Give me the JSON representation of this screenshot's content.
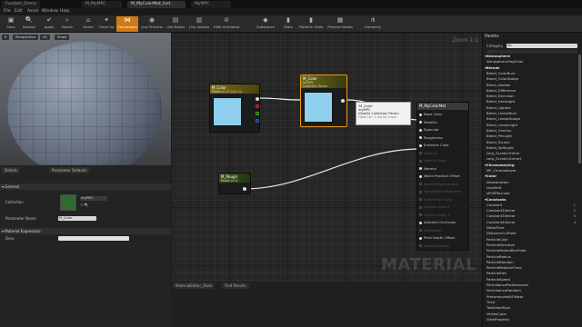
{
  "window": {
    "tabs": [
      "Fundam_Demo",
      "M_MyMPC",
      "M_MyColorMat_Inst",
      "MyMPC"
    ],
    "active_tab": 2
  },
  "menu": [
    "File",
    "Edit",
    "Asset",
    "Window",
    "Help"
  ],
  "toolbar": [
    {
      "icon": "save-icon",
      "label": "Save"
    },
    {
      "icon": "browse-icon",
      "label": "Browse"
    },
    {
      "icon": "apply-icon",
      "label": "Apply"
    },
    {
      "icon": "search-icon",
      "label": "Search"
    },
    {
      "icon": "home-icon",
      "label": "Home"
    },
    {
      "icon": "cleanup-icon",
      "label": "Clean Up"
    },
    {
      "icon": "connectors-icon",
      "label": "Connectors",
      "active": true
    },
    {
      "icon": "live-preview-icon",
      "label": "Live Preview"
    },
    {
      "icon": "live-nodes-icon",
      "label": "Live Nodes"
    },
    {
      "icon": "live-update-icon",
      "label": "Live Update"
    },
    {
      "icon": "hide-unrelated-icon",
      "label": "Hide Unrelated"
    },
    {
      "icon": "substance-icon",
      "label": "Substance"
    },
    {
      "icon": "stats-icon",
      "label": "Stats"
    },
    {
      "icon": "platform-stats-icon",
      "label": "Platform Stats"
    },
    {
      "icon": "preview-nodes-icon",
      "label": "Preview Nodes"
    },
    {
      "icon": "hierarchy-icon",
      "label": "Hierarchy"
    }
  ],
  "viewport": {
    "buttons": [
      "Perspective",
      "Lit",
      "Show"
    ]
  },
  "details": {
    "tabs": [
      "Details",
      "Parameter Defaults"
    ],
    "general_label": "General",
    "collection_label": "Collection",
    "collection_value": "myMPC",
    "parameter_name_label": "Parameter Name",
    "parameter_name_value": "M_Color",
    "material_expression_label": "Material Expression",
    "desc_label": "Desc"
  },
  "graph": {
    "zoom": "Zoom 1:1",
    "watermark": "MATERIAL",
    "node_color": {
      "title": "M_Color",
      "subtitle": "Param (0.17,0.6,1,0)"
    },
    "node_mpc": {
      "title": "M_Color",
      "subtitle": "myMPC",
      "subtitle2": "Collection Param"
    },
    "node_rough": {
      "title": "M_Rough",
      "subtitle": "Param (0.2)"
    },
    "node_material": {
      "title": "M_MyColorMat",
      "inputs": [
        {
          "label": "Base Color",
          "active": true
        },
        {
          "label": "Metallic",
          "active": true
        },
        {
          "label": "Specular",
          "active": true
        },
        {
          "label": "Roughness",
          "active": true
        },
        {
          "label": "Emissive Color",
          "active": true
        },
        {
          "label": "Opacity",
          "active": false
        },
        {
          "label": "Opacity Mask",
          "active": false
        },
        {
          "label": "Normal",
          "active": true
        },
        {
          "label": "World Position Offset",
          "active": true
        },
        {
          "label": "World Displacement",
          "active": false
        },
        {
          "label": "Tessellation Multiplier",
          "active": false
        },
        {
          "label": "Subsurface Color",
          "active": false
        },
        {
          "label": "Custom Data 0",
          "active": false
        },
        {
          "label": "Custom Data 1",
          "active": false
        },
        {
          "label": "Ambient Occlusion",
          "active": true
        },
        {
          "label": "Refraction",
          "active": false
        },
        {
          "label": "Pixel Depth Offset",
          "active": true
        },
        {
          "label": "Shading Model",
          "active": false
        }
      ]
    },
    "tooltip": [
      "'M_Color'",
      "myMPC",
      "(float4) Collection Param",
      "Hold Ctrl + Alt for more"
    ]
  },
  "bottom_tabs": [
    "MaterialEditor_Stats",
    "Find Results"
  ],
  "palette": {
    "title": "Palette",
    "category_label": "Category",
    "category_value": "All",
    "items": [
      {
        "text": "Atmosphere",
        "cat": true
      },
      {
        "text": "AtmosphericFogColor"
      },
      {
        "text": "Blends",
        "cat": true
      },
      {
        "text": "Blend_ColorBurn"
      },
      {
        "text": "Blend_ColorDodge"
      },
      {
        "text": "Blend_Darken"
      },
      {
        "text": "Blend_Difference"
      },
      {
        "text": "Blend_Exclusion"
      },
      {
        "text": "Blend_HardLight"
      },
      {
        "text": "Blend_Lighten"
      },
      {
        "text": "Blend_LinearBurn"
      },
      {
        "text": "Blend_LinearDodge"
      },
      {
        "text": "Blend_LinearLight"
      },
      {
        "text": "Blend_Overlay"
      },
      {
        "text": "Blend_PinLight"
      },
      {
        "text": "Blend_Screen"
      },
      {
        "text": "Blend_SoftLight"
      },
      {
        "text": "Lerp_ScratchGrime"
      },
      {
        "text": "Lerp_ScratchGrime2"
      },
      {
        "text": "Chromakeying",
        "cat": true
      },
      {
        "text": "MF_Chromakeyer"
      },
      {
        "text": "Color",
        "cat": true
      },
      {
        "text": "Desaturation"
      },
      {
        "text": "HueShift"
      },
      {
        "text": "sRGBToLinear"
      },
      {
        "text": "Constants",
        "cat": true
      },
      {
        "text": "Constant",
        "hk": "1"
      },
      {
        "text": "Constant2Vector",
        "hk": "2"
      },
      {
        "text": "Constant3Vector",
        "hk": "3"
      },
      {
        "text": "Constant4Vector",
        "hk": "4"
      },
      {
        "text": "DeltaTime"
      },
      {
        "text": "DistanceCullFade"
      },
      {
        "text": "ParticleColor"
      },
      {
        "text": "ParticleDirection"
      },
      {
        "text": "ParticleMotionBlurFade"
      },
      {
        "text": "ParticleRadius"
      },
      {
        "text": "ParticleRandom"
      },
      {
        "text": "ParticleRelativeTime"
      },
      {
        "text": "ParticleSize"
      },
      {
        "text": "ParticleSpeed"
      },
      {
        "text": "PerInstanceFadeAmount"
      },
      {
        "text": "PerInstanceRandom"
      },
      {
        "text": "PrecomputedAOMask"
      },
      {
        "text": "Time"
      },
      {
        "text": "TwoSidedSign"
      },
      {
        "text": "VertexColor"
      },
      {
        "text": "ViewProperty"
      }
    ]
  },
  "colors": {
    "accent": "#d07a14",
    "swatch": "#8ed0ee",
    "node_color_header": "#7a6a1a",
    "node_rough_header": "#3b5a1e"
  }
}
